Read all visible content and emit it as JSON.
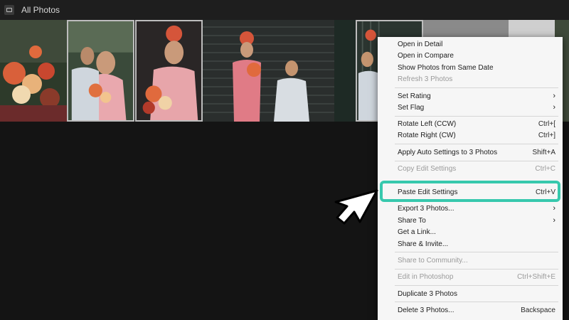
{
  "header": {
    "title": "All Photos",
    "icon": "photos-icon"
  },
  "thumbnails": [
    {
      "name": "photo-bouquet",
      "selected": false
    },
    {
      "name": "photo-couple-kiss",
      "selected": true
    },
    {
      "name": "photo-bride-laughing",
      "selected": true
    },
    {
      "name": "photo-couple-shutter",
      "selected": false
    },
    {
      "name": "photo-couple-railing",
      "selected": true
    },
    {
      "name": "photo-street",
      "selected": false
    }
  ],
  "menu": {
    "open_detail": "Open in Detail",
    "open_compare": "Open in Compare",
    "show_same_date": "Show Photos from Same Date",
    "refresh": "Refresh 3 Photos",
    "set_rating": "Set Rating",
    "set_flag": "Set Flag",
    "rotate_left": "Rotate Left (CCW)",
    "rotate_left_sc": "Ctrl+[",
    "rotate_right": "Rotate Right (CW)",
    "rotate_right_sc": "Ctrl+]",
    "auto_settings": "Apply Auto Settings to 3 Photos",
    "auto_settings_sc": "Shift+A",
    "copy_edit": "Copy Edit Settings",
    "copy_edit_sc": "Ctrl+C",
    "paste_edit": "Paste Edit Settings",
    "paste_edit_sc": "Ctrl+V",
    "export": "Export 3 Photos...",
    "share_to": "Share To",
    "get_link": "Get a Link...",
    "share_invite": "Share & Invite...",
    "share_community": "Share to Community...",
    "edit_photoshop": "Edit in Photoshop",
    "edit_photoshop_sc": "Ctrl+Shift+E",
    "duplicate": "Duplicate 3 Photos",
    "delete": "Delete 3 Photos...",
    "delete_sc": "Backspace"
  },
  "colors": {
    "highlight": "#37c8ad",
    "menu_bg": "#f6f6f6",
    "app_bg": "#141414"
  }
}
